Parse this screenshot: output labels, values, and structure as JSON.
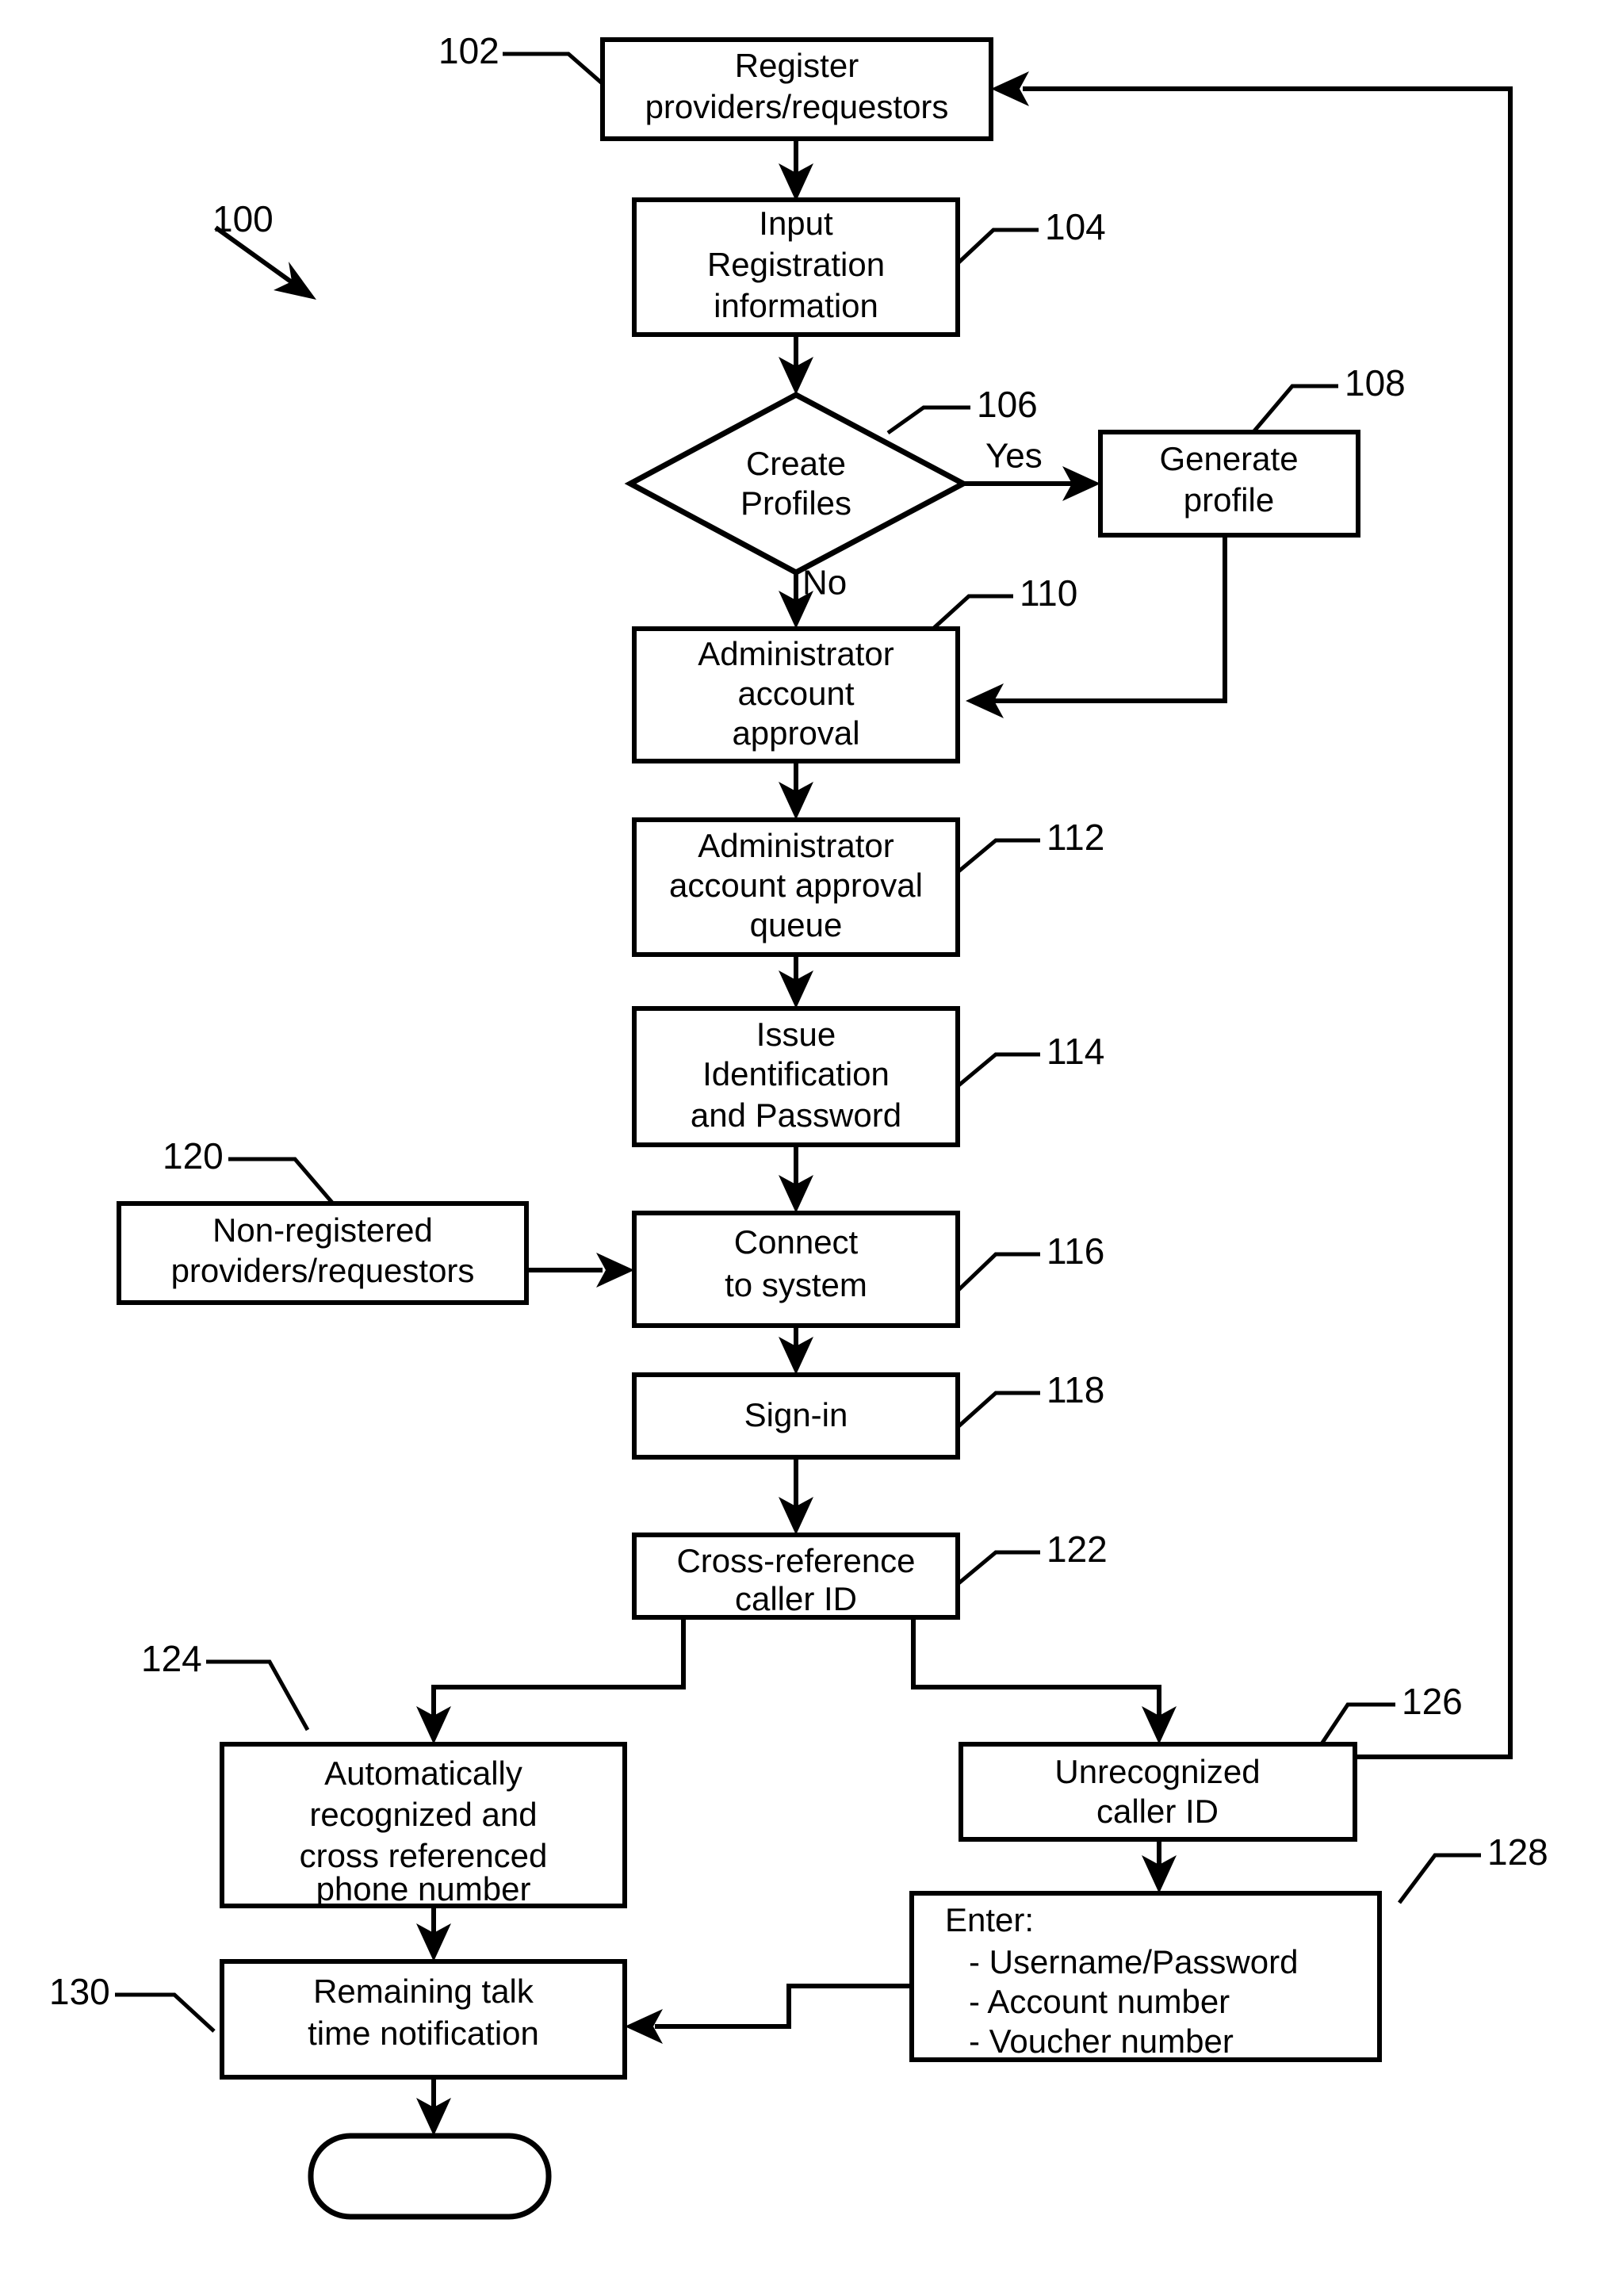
{
  "figure": {
    "ref_label": "100",
    "nodes": [
      {
        "id": "n102",
        "ref": "102",
        "lines": [
          "Register",
          "providers/requestors"
        ],
        "shape": "process"
      },
      {
        "id": "n104",
        "ref": "104",
        "lines": [
          "Input",
          "Registration",
          "information"
        ],
        "shape": "process"
      },
      {
        "id": "n106",
        "ref": "106",
        "lines": [
          "Create",
          "Profiles"
        ],
        "shape": "decision"
      },
      {
        "id": "n108",
        "ref": "108",
        "lines": [
          "Generate",
          "profile"
        ],
        "shape": "process"
      },
      {
        "id": "n110",
        "ref": "110",
        "lines": [
          "Administrator",
          "account",
          "approval"
        ],
        "shape": "process"
      },
      {
        "id": "n112",
        "ref": "112",
        "lines": [
          "Administrator",
          "account approval",
          "queue"
        ],
        "shape": "process"
      },
      {
        "id": "n114",
        "ref": "114",
        "lines": [
          "Issue",
          "Identification",
          "and Password"
        ],
        "shape": "process"
      },
      {
        "id": "n116",
        "ref": "116",
        "lines": [
          "Connect",
          "to system"
        ],
        "shape": "process"
      },
      {
        "id": "n118",
        "ref": "118",
        "lines": [
          "Sign-in"
        ],
        "shape": "process"
      },
      {
        "id": "n120",
        "ref": "120",
        "lines": [
          "Non-registered",
          "providers/requestors"
        ],
        "shape": "process"
      },
      {
        "id": "n122",
        "ref": "122",
        "lines": [
          "Cross-reference",
          "caller ID"
        ],
        "shape": "process"
      },
      {
        "id": "n124",
        "ref": "124",
        "lines": [
          "Automatically",
          "recognized and",
          "cross referenced",
          "phone number"
        ],
        "shape": "process"
      },
      {
        "id": "n126",
        "ref": "126",
        "lines": [
          "Unrecognized",
          "caller ID"
        ],
        "shape": "process"
      },
      {
        "id": "n128",
        "ref": "128",
        "lines": [
          "Enter:",
          "  - Username/Password",
          "  - Account number",
          "  - Voucher number"
        ],
        "shape": "process"
      },
      {
        "id": "n130",
        "ref": "130",
        "lines": [
          "Remaining talk",
          "time notification"
        ],
        "shape": "process"
      },
      {
        "id": "n132",
        "ref": "",
        "lines": [],
        "shape": "terminator"
      }
    ],
    "branch_labels": {
      "yes": "Yes",
      "no": "No"
    },
    "node_text": {
      "n102_l1": "Register",
      "n102_l2": "providers/requestors",
      "n104_l1": "Input",
      "n104_l2": "Registration",
      "n104_l3": "information",
      "n106_l1": "Create",
      "n106_l2": "Profiles",
      "n108_l1": "Generate",
      "n108_l2": "profile",
      "n110_l1": "Administrator",
      "n110_l2": "account",
      "n110_l3": "approval",
      "n112_l1": "Administrator",
      "n112_l2": "account approval",
      "n112_l3": "queue",
      "n114_l1": "Issue",
      "n114_l2": "Identification",
      "n114_l3": "and Password",
      "n116_l1": "Connect",
      "n116_l2": "to system",
      "n118_l1": "Sign-in",
      "n120_l1": "Non-registered",
      "n120_l2": "providers/requestors",
      "n122_l1": "Cross-reference",
      "n122_l2": "caller ID",
      "n124_l1": "Automatically",
      "n124_l2": "recognized and",
      "n124_l3": "cross referenced",
      "n124_l4": "phone number",
      "n126_l1": "Unrecognized",
      "n126_l2": "caller ID",
      "n128_l1": "Enter:",
      "n128_l2": "- Username/Password",
      "n128_l3": "- Account number",
      "n128_l4": "- Voucher number",
      "n130_l1": "Remaining talk",
      "n130_l2": "time notification"
    },
    "refs": {
      "r100": "100",
      "r102": "102",
      "r104": "104",
      "r106": "106",
      "r108": "108",
      "r110": "110",
      "r112": "112",
      "r114": "114",
      "r116": "116",
      "r118": "118",
      "r120": "120",
      "r122": "122",
      "r124": "124",
      "r126": "126",
      "r128": "128",
      "r130": "130"
    },
    "colors": {
      "stroke": "#000000",
      "fill": "#ffffff",
      "background": "#ffffff"
    }
  }
}
